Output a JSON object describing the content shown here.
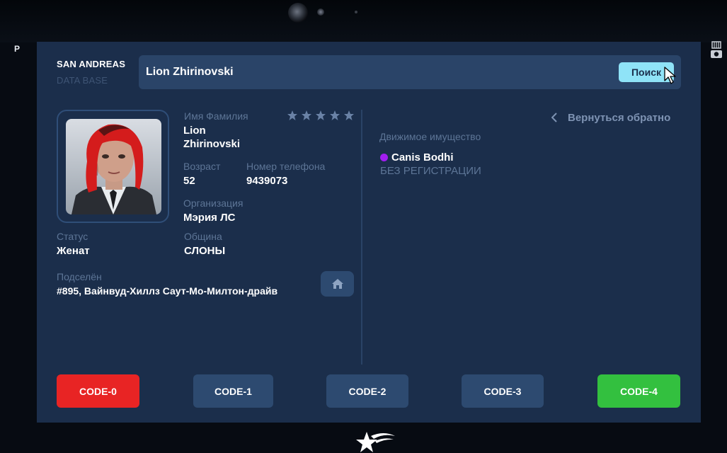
{
  "side": {
    "left_marker": "P"
  },
  "brand": {
    "title": "SAN ANDREAS",
    "subtitle": "DATA BASE"
  },
  "search": {
    "value": "Lion Zhirinovski",
    "button_label": "Поиск"
  },
  "profile": {
    "name_label": "Имя Фамилия",
    "first_name": "Lion",
    "last_name": "Zhirinovski",
    "wanted_stars_filled": 0,
    "wanted_stars_total": 5,
    "age_label": "Возраст",
    "age": "52",
    "phone_label": "Номер телефона",
    "phone": "9439073",
    "org_label": "Организация",
    "org": "Мэрия ЛС",
    "status_label": "Статус",
    "status": "Женат",
    "community_label": "Община",
    "community": "СЛОНЫ",
    "residence_label": "Подселён",
    "residence": "#895, Вайнвуд-Хиллз Саут-Мо-Милтон-драйв",
    "home_icon": "home-icon"
  },
  "right_panel": {
    "back_label": "Вернуться обратно",
    "property_label": "Движимое имущество",
    "vehicle_name": "Canis Bodhi",
    "vehicle_status": "БЕЗ РЕГИСТРАЦИИ",
    "vehicle_color": "#a11ef0"
  },
  "codes": [
    {
      "label": "CODE-0",
      "color": "#e82424"
    },
    {
      "label": "CODE-1",
      "color": "#2d4a70"
    },
    {
      "label": "CODE-2",
      "color": "#2d4a70"
    },
    {
      "label": "CODE-3",
      "color": "#2d4a70"
    },
    {
      "label": "CODE-4",
      "color": "#33c03f"
    }
  ],
  "colors": {
    "screen_bg": "#1b2e4b",
    "accent": "#8fe3f7"
  }
}
